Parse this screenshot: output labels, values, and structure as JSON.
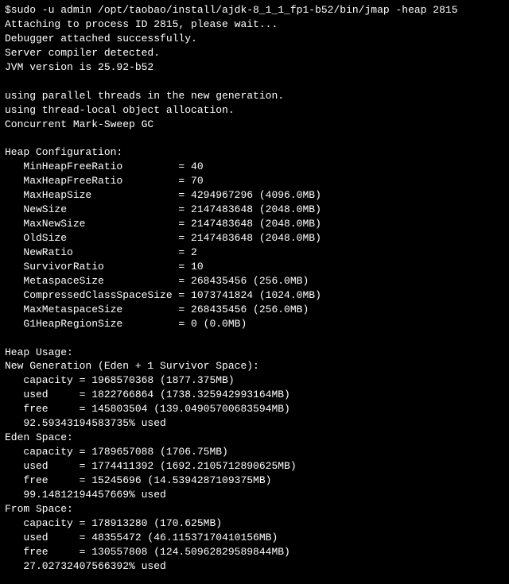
{
  "command": "$sudo -u admin /opt/taobao/install/ajdk-8_1_1_fp1-b52/bin/jmap -heap 2815",
  "preamble": [
    "Attaching to process ID 2815, please wait...",
    "Debugger attached successfully.",
    "Server compiler detected.",
    "JVM version is 25.92-b52",
    "",
    "using parallel threads in the new generation.",
    "using thread-local object allocation.",
    "Concurrent Mark-Sweep GC",
    ""
  ],
  "heap_config_title": "Heap Configuration:",
  "heap_config": [
    {
      "k": "MinHeapFreeRatio",
      "v": "40"
    },
    {
      "k": "MaxHeapFreeRatio",
      "v": "70"
    },
    {
      "k": "MaxHeapSize",
      "v": "4294967296 (4096.0MB)"
    },
    {
      "k": "NewSize",
      "v": "2147483648 (2048.0MB)"
    },
    {
      "k": "MaxNewSize",
      "v": "2147483648 (2048.0MB)"
    },
    {
      "k": "OldSize",
      "v": "2147483648 (2048.0MB)"
    },
    {
      "k": "NewRatio",
      "v": "2"
    },
    {
      "k": "SurvivorRatio",
      "v": "10"
    },
    {
      "k": "MetaspaceSize",
      "v": "268435456 (256.0MB)"
    },
    {
      "k": "CompressedClassSpaceSize",
      "v": "1073741824 (1024.0MB)"
    },
    {
      "k": "MaxMetaspaceSize",
      "v": "268435456 (256.0MB)"
    },
    {
      "k": "G1HeapRegionSize",
      "v": "0 (0.0MB)"
    }
  ],
  "heap_usage_title": "Heap Usage:",
  "sections": [
    {
      "title": "New Generation (Eden + 1 Survivor Space):",
      "rows": [
        {
          "k": "capacity",
          "v": "1968570368 (1877.375MB)"
        },
        {
          "k": "used",
          "v": "1822766864 (1738.325942993164MB)"
        },
        {
          "k": "free",
          "v": "145803504 (139.04905700683594MB)"
        }
      ],
      "pct": "92.59343194583735% used"
    },
    {
      "title": "Eden Space:",
      "rows": [
        {
          "k": "capacity",
          "v": "1789657088 (1706.75MB)"
        },
        {
          "k": "used",
          "v": "1774411392 (1692.2105712890625MB)"
        },
        {
          "k": "free",
          "v": "15245696 (14.5394287109375MB)"
        }
      ],
      "pct": "99.14812194457669% used"
    },
    {
      "title": "From Space:",
      "rows": [
        {
          "k": "capacity",
          "v": "178913280 (170.625MB)"
        },
        {
          "k": "used",
          "v": "48355472 (46.11537170410156MB)"
        },
        {
          "k": "free",
          "v": "130557808 (124.50962829589844MB)"
        }
      ],
      "pct": "27.02732407566392% used"
    }
  ]
}
